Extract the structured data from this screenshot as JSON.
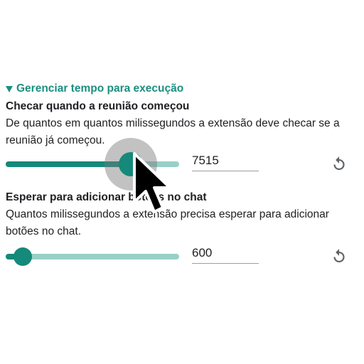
{
  "section": {
    "title": "Gerenciar tempo para execução",
    "icon": "triangle-down-icon",
    "accent_color": "#1a8f80"
  },
  "settings": [
    {
      "title": "Checar quando a reunião começou",
      "description": "De quantos em quantos milissegundos a extensão deve checar se a reunião já começou.",
      "value": "7515",
      "slider_fraction": 0.72,
      "reset_icon": "reset-icon"
    },
    {
      "title": "Esperar para adicionar botões no chat",
      "description": "Quantos milissegundos a extensão precisa esperar para adicionar botões no chat.",
      "value": "600",
      "slider_fraction": 0.1,
      "reset_icon": "reset-icon"
    }
  ],
  "colors": {
    "slider_active": "#15897a",
    "slider_inactive": "#98d0c8"
  }
}
